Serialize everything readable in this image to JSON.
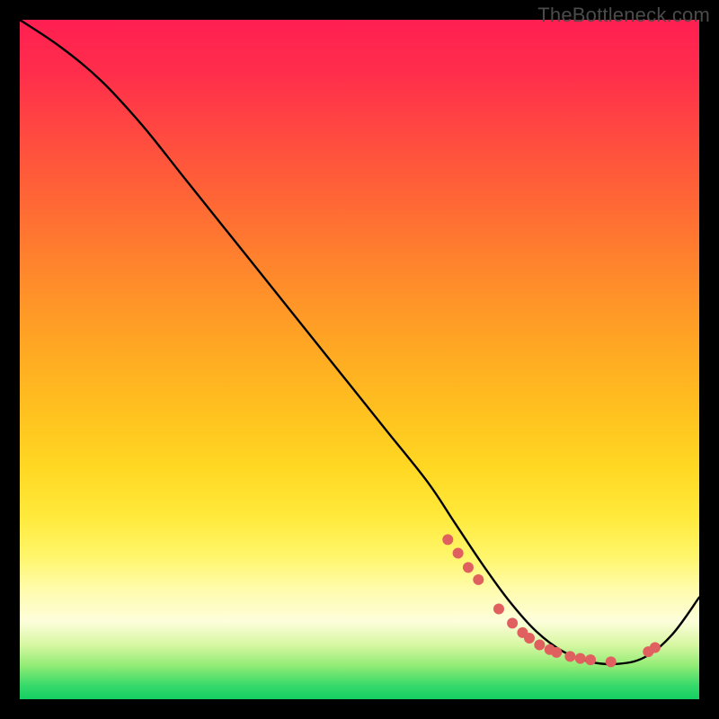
{
  "attribution": "TheBottleneck.com",
  "chart_data": {
    "type": "line",
    "title": "",
    "xlabel": "",
    "ylabel": "",
    "xlim": [
      0,
      100
    ],
    "ylim": [
      0,
      100
    ],
    "grid": false,
    "series": [
      {
        "name": "curve",
        "stroke": "#000000",
        "x": [
          0,
          6,
          12,
          18,
          24,
          30,
          36,
          42,
          48,
          54,
          60,
          64,
          68,
          72,
          76,
          80,
          84,
          88,
          92,
          96,
          100
        ],
        "y": [
          100,
          96,
          91,
          84.5,
          77,
          69.5,
          62,
          54.5,
          47,
          39.5,
          32,
          26,
          20,
          14.5,
          10,
          7,
          5.5,
          5.2,
          6.2,
          9.5,
          15
        ]
      }
    ],
    "markers": {
      "name": "dots",
      "color": "#e06060",
      "radius_px": 6,
      "x": [
        63.0,
        64.5,
        66.0,
        67.5,
        70.5,
        72.5,
        74.0,
        75.0,
        76.5,
        78.0,
        79.0,
        81.0,
        82.5,
        84.0,
        87.0,
        92.5,
        93.5
      ],
      "y": [
        23.5,
        21.5,
        19.4,
        17.6,
        13.3,
        11.2,
        9.8,
        9.0,
        8.0,
        7.3,
        6.9,
        6.3,
        6.0,
        5.8,
        5.5,
        7.0,
        7.6
      ]
    },
    "background_gradient": {
      "direction": "vertical",
      "stops": [
        {
          "pos": 0.0,
          "color": "#ff1f52"
        },
        {
          "pos": 0.5,
          "color": "#ffc21f"
        },
        {
          "pos": 0.85,
          "color": "#fdfedb"
        },
        {
          "pos": 1.0,
          "color": "#13cf62"
        }
      ]
    }
  }
}
